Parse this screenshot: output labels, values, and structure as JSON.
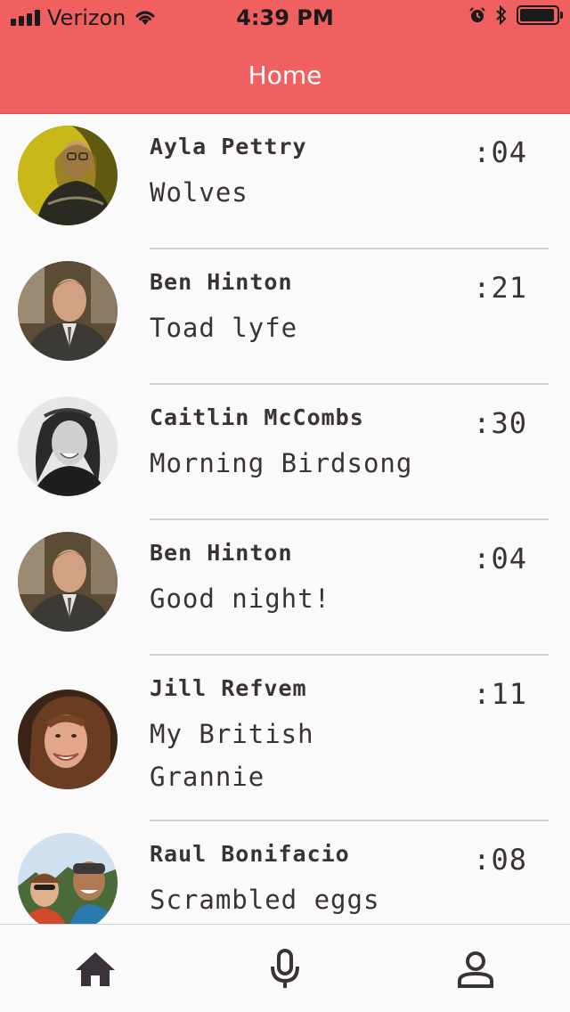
{
  "status_bar": {
    "carrier": "Verizon",
    "time": "4:39 PM",
    "battery_level": 0.95
  },
  "header": {
    "title": "Home"
  },
  "messages": [
    {
      "name": "Ayla Pettry",
      "message": "Wolves",
      "time": ":04"
    },
    {
      "name": "Ben Hinton",
      "message": "Toad lyfe",
      "time": ":21"
    },
    {
      "name": "Caitlin McCombs",
      "message": "Morning Birdsong",
      "time": ":30"
    },
    {
      "name": "Ben Hinton",
      "message": "Good night!",
      "time": ":04"
    },
    {
      "name": "Jill Refvem",
      "message": "My British Grannie",
      "time": ":11"
    },
    {
      "name": "Raul Bonifacio",
      "message": "Scrambled eggs",
      "time": ":08"
    }
  ],
  "tabbar": {
    "tabs": [
      {
        "icon": "home-icon"
      },
      {
        "icon": "microphone-icon"
      },
      {
        "icon": "person-icon"
      }
    ]
  },
  "colors": {
    "header_bg": "#f06060",
    "header_text": "#ffffff",
    "text": "#3a3238"
  }
}
